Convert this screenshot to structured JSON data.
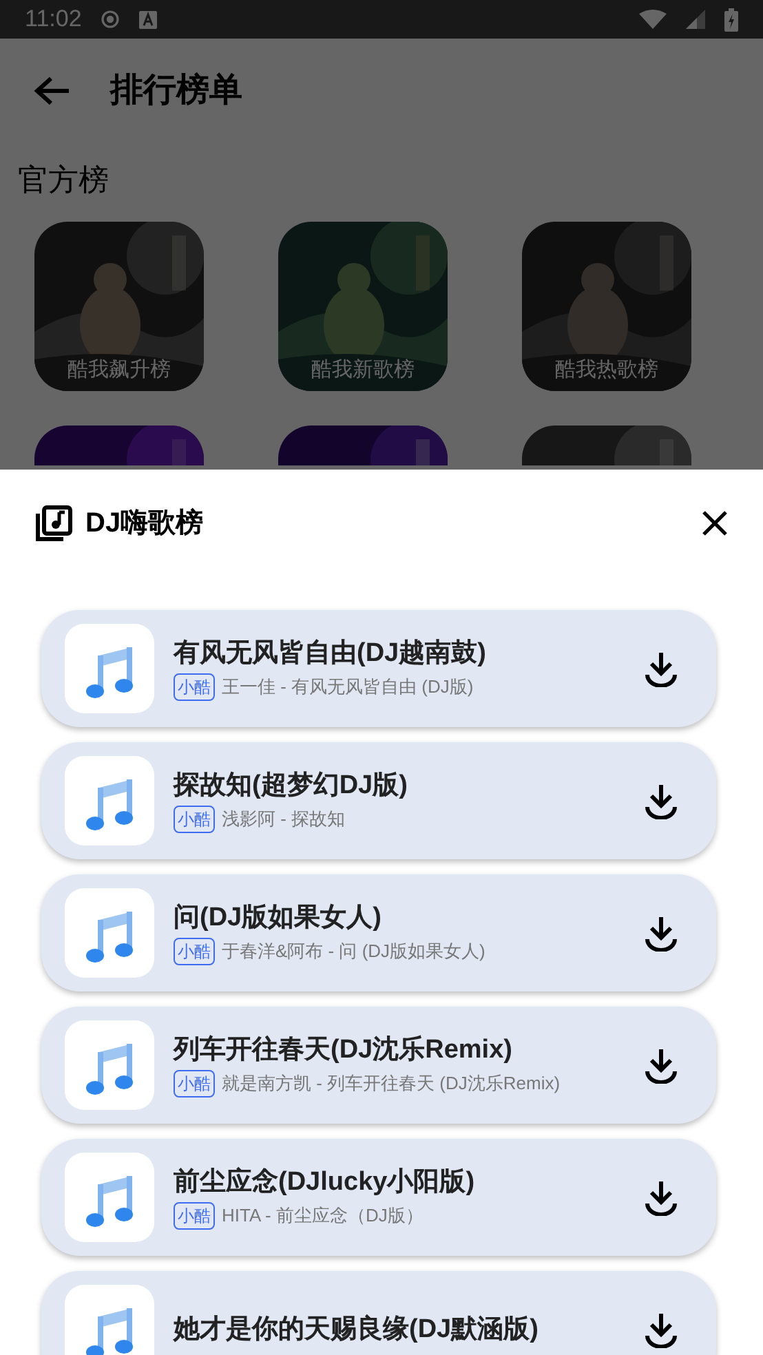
{
  "status_bar": {
    "time": "11:02"
  },
  "app_bar": {
    "title": "排行榜单"
  },
  "section": {
    "title": "官方榜",
    "charts": [
      {
        "label": "酷我飙升榜"
      },
      {
        "label": "酷我新歌榜"
      },
      {
        "label": "酷我热歌榜"
      }
    ]
  },
  "sheet": {
    "title": "DJ嗨歌榜",
    "songs": [
      {
        "title": "有风无风皆自由(DJ越南鼓)",
        "badge": "小酷",
        "subtitle": "王一佳 - 有风无风皆自由 (DJ版)"
      },
      {
        "title": "探故知(超梦幻DJ版)",
        "badge": "小酷",
        "subtitle": "浅影阿 - 探故知"
      },
      {
        "title": "问(DJ版如果女人)",
        "badge": "小酷",
        "subtitle": "于春洋&阿布 - 问 (DJ版如果女人)"
      },
      {
        "title": "列车开往春天(DJ沈乐Remix)",
        "badge": "小酷",
        "subtitle": "就是南方凯 - 列车开往春天 (DJ沈乐Remix)"
      },
      {
        "title": "前尘应念(DJlucky小阳版)",
        "badge": "小酷",
        "subtitle": "HITA - 前尘应念（DJ版）"
      },
      {
        "title": "她才是你的天赐良缘(DJ默涵版)"
      }
    ]
  }
}
